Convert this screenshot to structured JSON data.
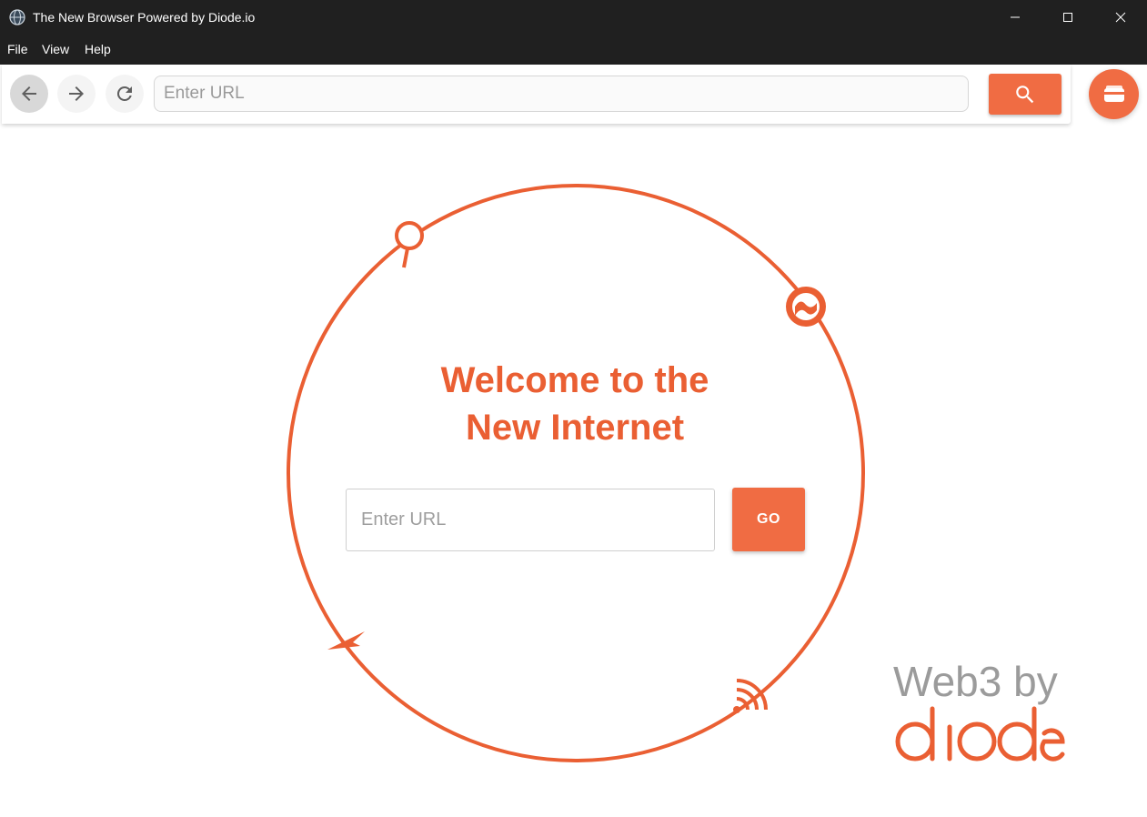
{
  "window": {
    "title": "The New Browser Powered by Diode.io"
  },
  "menu": {
    "items": [
      "File",
      "View",
      "Help"
    ]
  },
  "toolbar": {
    "url_placeholder": "Enter URL"
  },
  "main": {
    "welcome_line1": "Welcome to the",
    "welcome_line2": "New Internet",
    "url_placeholder": "Enter URL",
    "go_label": "GO"
  },
  "branding": {
    "tagline": "Web3 by",
    "logo_text": "diode"
  },
  "colors": {
    "accent": "#f06c43",
    "heading": "#ea5f33",
    "orbit": "#ea5f33",
    "titlebar": "#202020",
    "tagline": "#9b9b9b"
  },
  "icons": {
    "nav_back": "arrow-left-icon",
    "nav_forward": "arrow-right-icon",
    "reload": "reload-icon",
    "search": "search-icon",
    "wallet": "wallet-icon",
    "orbit_markers": [
      "magnifier-icon",
      "globe-icon",
      "rocket-icon",
      "signal-icon"
    ]
  }
}
